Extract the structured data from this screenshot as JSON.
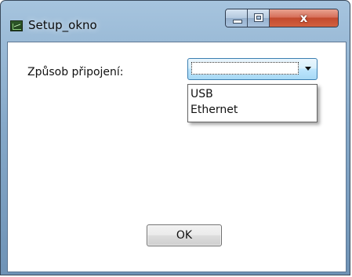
{
  "window": {
    "title": "Setup_okno",
    "icon": "chart-app-icon",
    "controls": {
      "minimize_icon": "minimize-icon",
      "maximize_icon": "maximize-icon",
      "close_glyph": "x"
    }
  },
  "form": {
    "connection_label": "Způsob připojení:",
    "connection_select": {
      "selected_value": "",
      "expanded": true,
      "options": [
        "USB",
        "Ethernet"
      ]
    },
    "ok_label": "OK"
  },
  "colors": {
    "titlebar": "#86a9c9",
    "close_button": "#c24a2e",
    "combo_border": "#3c7fb1"
  }
}
